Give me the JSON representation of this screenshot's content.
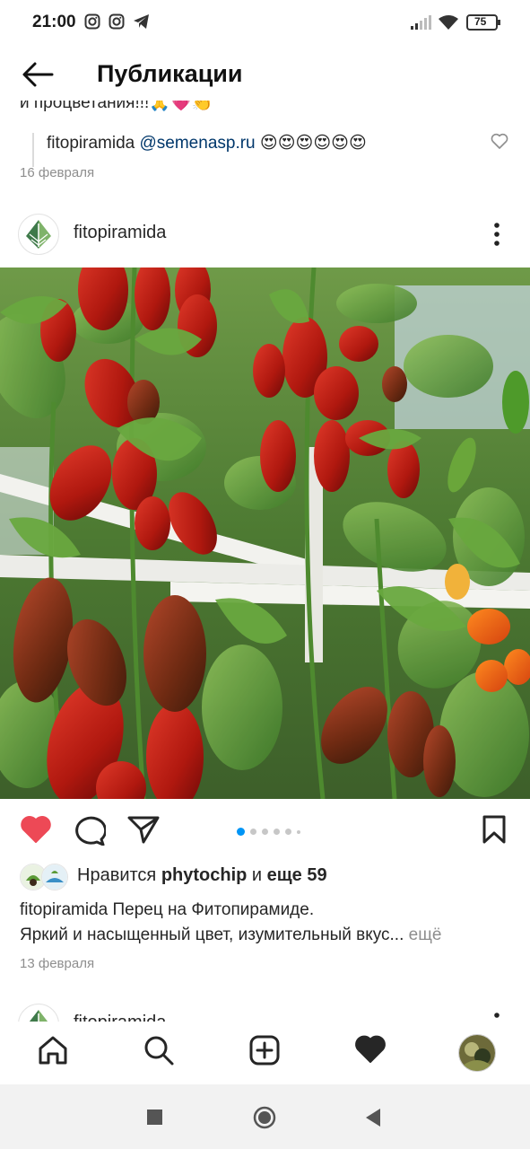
{
  "status_bar": {
    "time": "21:00",
    "battery": "75"
  },
  "header": {
    "title": "Публикации"
  },
  "previous_post": {
    "caption_tail": "и процветания!!!🙏💗👏",
    "reply_user": "fitopiramida",
    "reply_mention": "@semenasp.ru",
    "reply_emojis": "😍😍😍😍😍😍",
    "date": "16 февраля"
  },
  "post": {
    "username": "fitopiramida",
    "carousel": {
      "count": 6,
      "active_index": 0
    },
    "likes_prefix": "Нравится ",
    "likes_user": "phytochip",
    "likes_middle": " и ",
    "likes_others": "еще 59",
    "caption_user": "fitopiramida",
    "caption_line1": "Перец на Фитопирамиде.",
    "caption_line2": "Яркий и насыщенный цвет, изумительный вкус...",
    "caption_more": " ещё",
    "date": "13 февраля"
  },
  "next_post": {
    "username": "fitopiramida"
  },
  "icons": {
    "back": "arrow-left-icon",
    "like": "heart-filled-icon",
    "comment": "comment-icon",
    "share": "paper-plane-icon",
    "save": "bookmark-icon",
    "more": "more-vertical-icon",
    "nav_home": "home-icon",
    "nav_search": "search-icon",
    "nav_add": "add-post-icon",
    "nav_activity": "heart-icon",
    "nav_profile": "profile-avatar"
  },
  "colors": {
    "like_red": "#ed4956",
    "link_blue": "#00376b",
    "carousel_active": "#0095f6",
    "muted": "#8e8e8e"
  }
}
